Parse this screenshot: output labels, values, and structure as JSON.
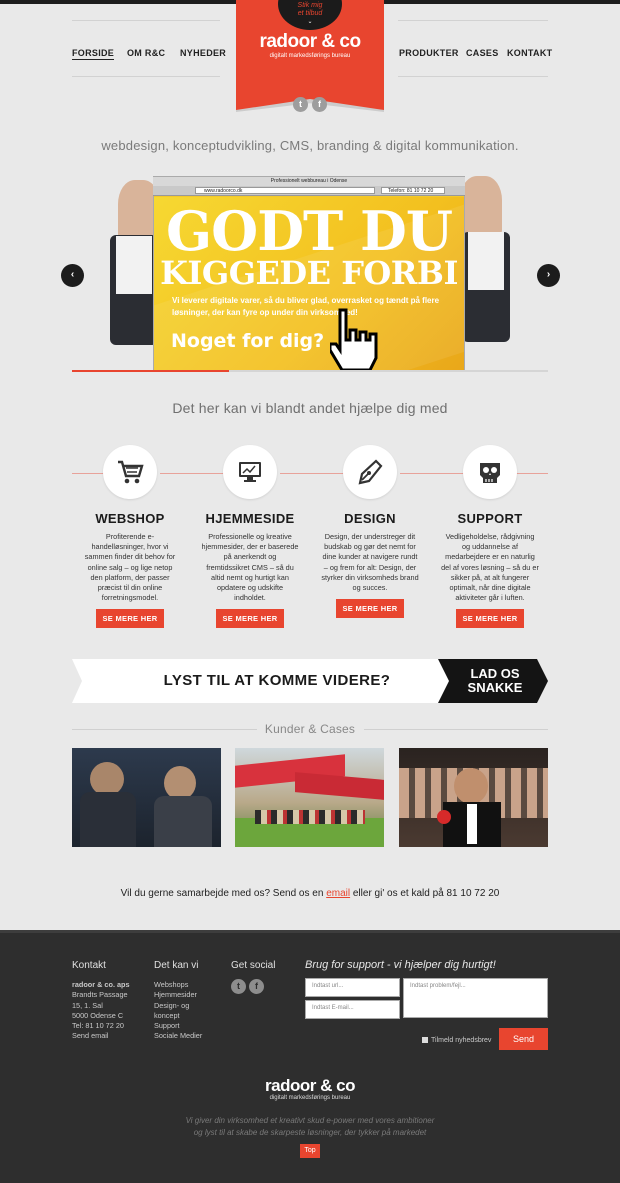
{
  "header": {
    "nav_left": [
      "FORSIDE",
      "OM R&C",
      "NYHEDER"
    ],
    "nav_right": [
      "PRODUKTER",
      "CASES",
      "KONTAKT"
    ],
    "logo": "radoor & co",
    "logo_sub": "digitalt markedsførings bureau",
    "stik_line1": "Stik mig",
    "stik_line2": "et tilbud",
    "stik_chevron": "⌄",
    "social_twitter": "t",
    "social_facebook": "f"
  },
  "tagline": "webdesign, konceptudvikling, CMS, branding & digital kommunikation.",
  "slider": {
    "browser_title": "Professionelt webbureau i Odense",
    "browser_url": "www.radoorco.dk",
    "browser_phone": "Telefon: 81 10 72 20",
    "headline1": "GODT DU",
    "headline2": "KIGGEDE FORBI",
    "text": "Vi leverer digitale varer, så du bliver glad, overrasket og tændt på flere løsninger, der kan fyre op under    din virksomhed!",
    "cta": "Noget for dig?",
    "prev": "‹",
    "next": "›",
    "progress": 0.33
  },
  "services_heading": "Det her kan vi blandt andet hjælpe dig med",
  "services": [
    {
      "title": "WEBSHOP",
      "text": "Profiterende e-handelløsninger, hvor vi sammen finder dit behov for online salg – og lige netop den platform, der passer præcist til din online forretningsmodel.",
      "button": "SE MERE HER",
      "icon": "cart-icon"
    },
    {
      "title": "HJEMMESIDE",
      "text": "Professionelle og kreative hjemmesider, der er baserede på anerkendt og fremtidssikret CMS – så du altid nemt og hurtigt kan opdatere og udskifte indholdet.",
      "button": "SE MERE HER",
      "icon": "monitor-icon"
    },
    {
      "title": "DESIGN",
      "text": "Design, der understreger dit budskab og gør det nemt for dine kunder at navigere rundt – og frem for alt: Design, der styrker din virksomheds brand og succes.",
      "button": "SE MERE HER",
      "icon": "pen-icon"
    },
    {
      "title": "SUPPORT",
      "text": "Vedligeholdelse, rådgivning og uddannelse af medarbejdere er en naturlig del af vores løsning – så du er sikker på, at alt fungerer optimalt, når dine digitale aktiviteter går i luften.",
      "button": "SE MERE HER",
      "icon": "skull-icon"
    }
  ],
  "cta_banner": {
    "question": "LYST TIL AT KOMME VIDERE?",
    "button_line1": "LAD OS",
    "button_line2": "SNAKKE"
  },
  "cases_heading": "Kunder & Cases",
  "contact_line": {
    "before": "Vil du gerne samarbejde med os? Send os en ",
    "link": "email",
    "after": " eller gi' os et kald på 81 10 72 20"
  },
  "footer": {
    "kontakt_heading": "Kontakt",
    "company": "radoor & co. aps",
    "address1": "Brandts Passage",
    "address2": "15, 1. Sal",
    "address3": "5000 Odense C",
    "phone": "Tel: 81 10 72 20",
    "email": "Send email",
    "detkanvi_heading": "Det kan vi",
    "detkanvi_items": [
      "Webshops",
      "Hjemmesider",
      "Design- og",
      "koncept",
      "Support",
      "Sociale Medier"
    ],
    "social_heading": "Get social",
    "support_heading": "Brug for support - vi hjælper dig hurtigt!",
    "url_placeholder": "Indtast url...",
    "email_placeholder": "Indtast E-mail...",
    "problem_placeholder": "Indtast problem/fejl...",
    "newsletter": "Tilmeld nyhedsbrev",
    "send": "Send",
    "logo": "radoor & co",
    "logo_sub": "digitalt markedsførings bureau",
    "tag_line1": "Vi giver din virksomhed et kreativt skud e-power med vores ambitioner",
    "tag_line2": "og lyst til at skabe de skarpeste løsninger, der tykker på markedet",
    "top": "Top"
  },
  "colors": {
    "accent": "#e8452f",
    "dark": "#2e2e2e",
    "yellow": "#f4c928"
  }
}
